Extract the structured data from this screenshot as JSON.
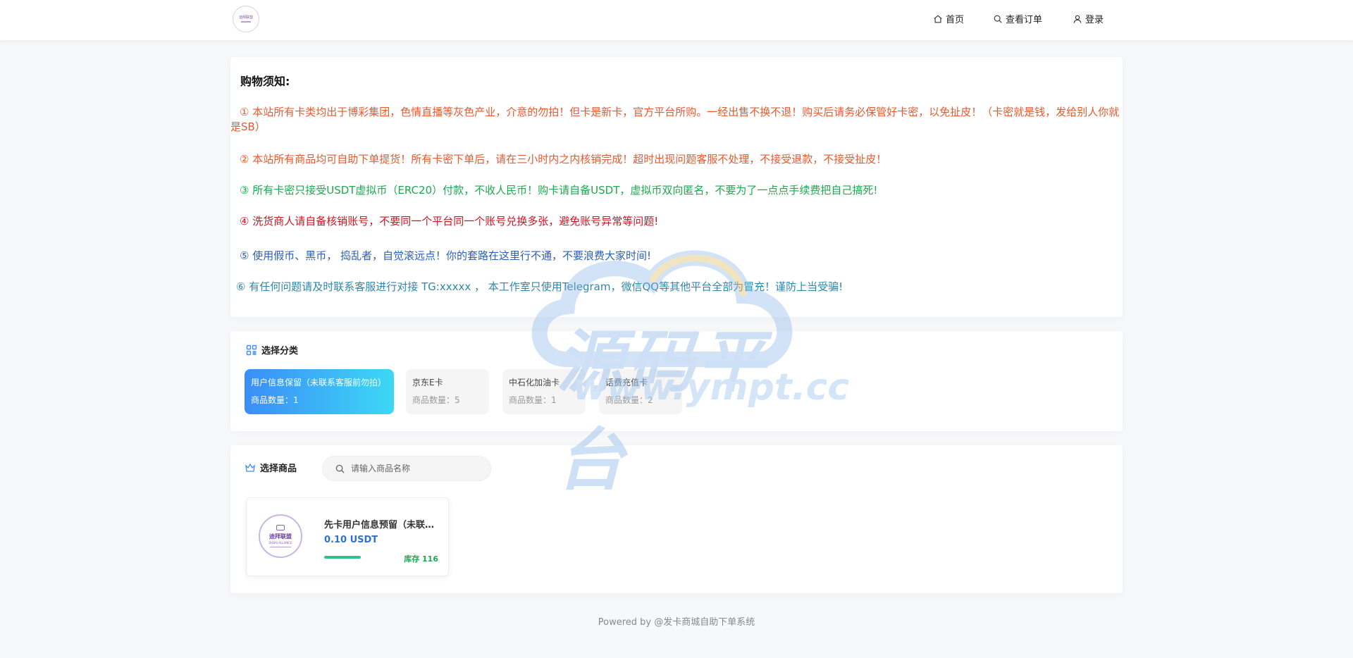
{
  "logo": {
    "text": "迪拜联盟"
  },
  "nav": {
    "home": "首页",
    "orders": "查看订单",
    "login": "登录"
  },
  "notice": {
    "title": "购物须知:",
    "lines": [
      "① 本站所有卡类均出于博彩集团，色情直播等灰色产业，介意的勿拍！但卡是新卡，官方平台所购。一经出售不换不退！购买后请务必保管好卡密，以免扯皮！（卡密就是钱，发给别人你就是SB）",
      "② 本站所有商品均可自助下单提货！所有卡密下单后，请在三小时内之内核销完成！超时出现问题客服不处理，不接受退款，不接受扯皮！",
      "③ 所有卡密只接受USDT虚拟币（ERC20）付款，不收人民币！购卡请自备USDT，虚拟币双向匿名，不要为了一点点手续费把自己搞死!",
      "④ 洗货商人请自备核销账号，不要同一个平台同一个账号兑换多张，避免账号异常等问题!",
      "⑤ 使用假币、黑币， 捣乱者，自觉滚远点！你的套路在这里行不通，不要浪费大家时间!",
      "⑥ 有任何问题请及时联系客服进行对接 TG:xxxxx ， 本工作室只使用Telegram，微信QQ等其他平台全部为冒充！谨防上当受骗!"
    ],
    "colors": [
      "#e8592e",
      "#e8592e",
      "#1da94e",
      "#cf1322",
      "#2b5fb8",
      "#2f87a8"
    ]
  },
  "watermark": {
    "big": "源码平台",
    "small": "www.ympt.cc"
  },
  "category": {
    "title": "选择分类",
    "items": [
      {
        "name": "用户信息保留（未联系客服前勿拍）",
        "count": "商品数量：1",
        "active": true
      },
      {
        "name": "京东E卡",
        "count": "商品数量：5",
        "active": false
      },
      {
        "name": "中石化加油卡",
        "count": "商品数量：1",
        "active": false
      },
      {
        "name": "话费充值卡",
        "count": "商品数量：2",
        "active": false
      }
    ]
  },
  "goods": {
    "title": "选择商品",
    "search_placeholder": "请输入商品名称",
    "items": [
      {
        "name": "先卡用户信息预留（未联系客服前勿拍）",
        "price": "0.10 USDT",
        "stock": "库存 116",
        "stock_level": 1.0,
        "image_text": "迪拜联盟",
        "image_subtext": "DUBAI ALLIANCE"
      }
    ]
  },
  "footer": {
    "text": "Powered by @发卡商城自助下单系统"
  },
  "theme": {
    "accent": "#3b8df7",
    "accent2": "#3dd8f5",
    "price": "#2f6fd6",
    "stock": "#1da94e"
  }
}
